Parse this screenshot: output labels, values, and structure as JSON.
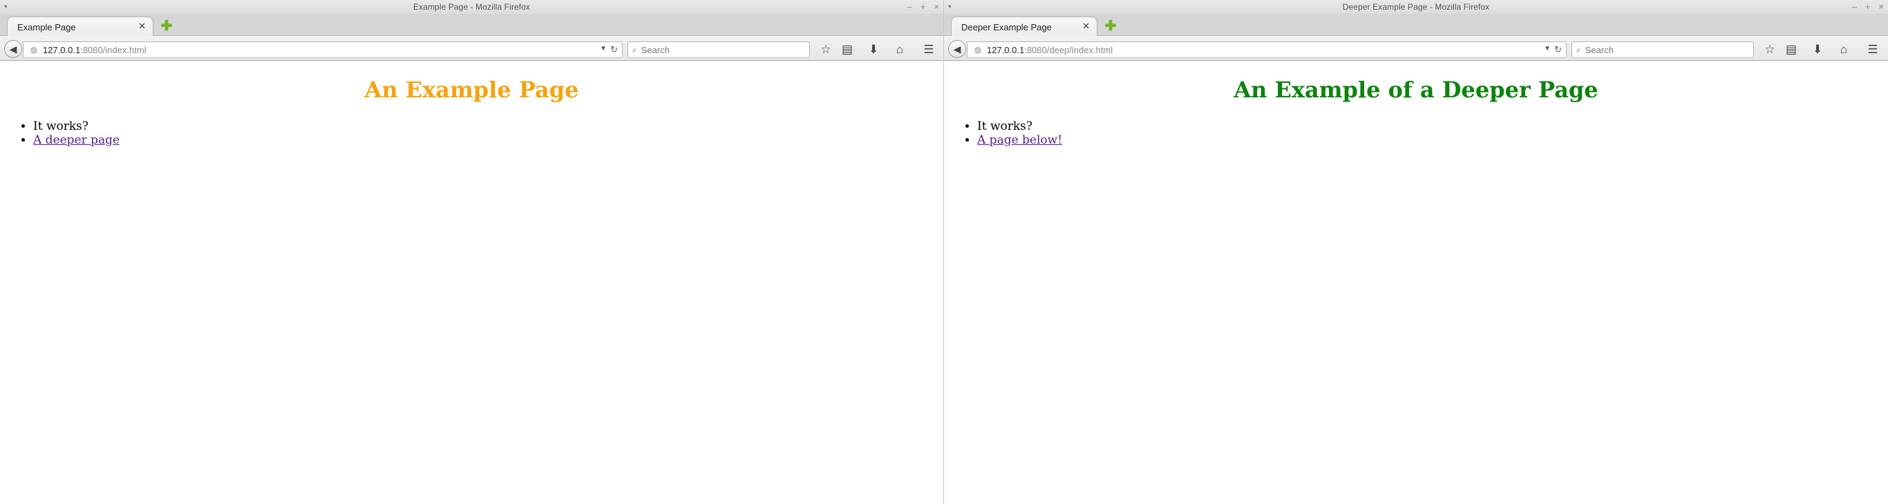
{
  "windows": [
    {
      "window_title": "Example Page - Mozilla Firefox",
      "tab_label": "Example Page",
      "url_host": "127.0.0.1",
      "url_path": ":8080/index.html",
      "search_placeholder": "Search",
      "heading": "An Example Page",
      "heading_color": "#f7a20f",
      "list_items": [
        "It works?"
      ],
      "link_text": "A deeper page"
    },
    {
      "window_title": "Deeper Example Page - Mozilla Firefox",
      "tab_label": "Deeper Example Page",
      "url_host": "127.0.0.1",
      "url_path": ":8080/deep/index.html",
      "search_placeholder": "Search",
      "heading": "An Example of a Deeper Page",
      "heading_color": "#0c830c",
      "list_items": [
        "It works?"
      ],
      "link_text": "A page below!"
    }
  ]
}
